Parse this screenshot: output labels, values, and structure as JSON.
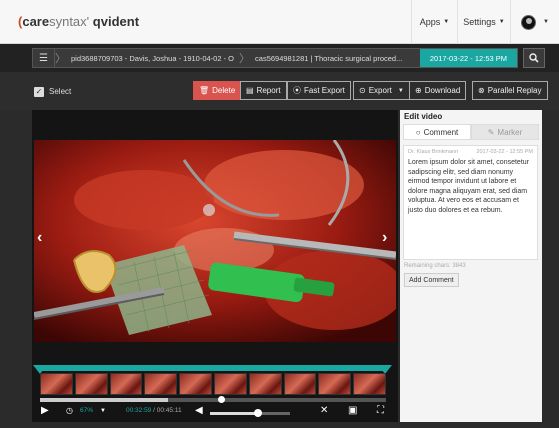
{
  "header": {
    "logo_mark": "(",
    "logo_brand": "care",
    "logo_brand2": "syntax",
    "logo_tm": "'",
    "logo_product_q": "q",
    "logo_product": "vident",
    "apps_label": "Apps",
    "settings_label": "Settings"
  },
  "breadcrumb": {
    "patient": "pid3688709703 - Davis, Joshua - 1910-04-02 - O",
    "case": "cas5694981281 | Thoracic surgical proced...",
    "video": "2017-03-22 - 12:53 PM"
  },
  "toolbar": {
    "select_label": "Select",
    "delete_label": "Delete",
    "report_label": "Report",
    "fast_export_label": "Fast Export",
    "export_label": "Export",
    "download_label": "Download",
    "parallel_replay_label": "Parallel Replay"
  },
  "player": {
    "speed": "67%",
    "current_time": "00:32:59",
    "duration": "00:45:11",
    "time_separator": "/",
    "seek_fraction": 0.37,
    "volume_fraction": 0.6
  },
  "edit_panel": {
    "title": "Edit video",
    "tab_comment": "Comment",
    "tab_marker": "Marker",
    "author": "Dr. Klaus Brinkmann",
    "timestamp": "2017-03-22 - 12:55 PM",
    "comment_text": "Lorem ipsum dolor sit amet, consetetur sadipscing elitr, sed diam nonumy eirmod tempor invidunt ut labore et dolore magna aliquyam erat, sed diam voluptua. At vero eos et accusam et justo duo dolores et ea rebum.",
    "remaining_chars": "Remaining chars: 3843",
    "add_comment_label": "Add Comment"
  },
  "colors": {
    "accent": "#1aa6a1",
    "danger": "#d9534f",
    "brand": "#c8501e"
  }
}
